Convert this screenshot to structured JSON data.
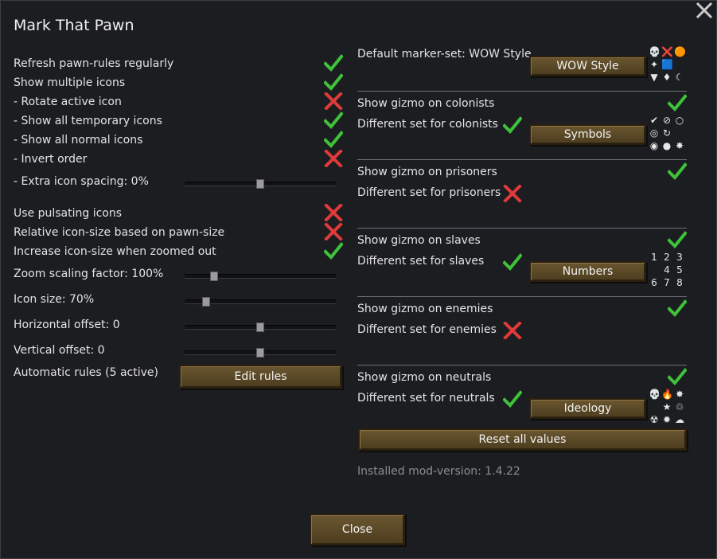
{
  "window": {
    "title": "Mark That Pawn",
    "close_glyph": "✕"
  },
  "left": {
    "toggles": [
      {
        "label": "Refresh pawn-rules regularly",
        "checked": true
      },
      {
        "label": "Show multiple icons",
        "checked": true
      },
      {
        "label": "- Rotate active icon",
        "checked": false
      },
      {
        "label": "- Show all temporary icons",
        "checked": true
      },
      {
        "label": "- Show all normal icons",
        "checked": true
      },
      {
        "label": "- Invert order",
        "checked": false
      }
    ],
    "extra_spacing": {
      "label": "- Extra icon spacing: 0%",
      "value_fraction": 0.5
    },
    "toggles2": [
      {
        "label": "Use pulsating icons",
        "checked": false
      },
      {
        "label": "Relative icon-size based on pawn-size",
        "checked": false
      },
      {
        "label": "Increase icon-size when zoomed out",
        "checked": true
      }
    ],
    "sliders": [
      {
        "label": "Zoom scaling factor: 100%",
        "value_fraction": 0.18
      },
      {
        "label": "Icon size: 70%",
        "value_fraction": 0.12
      },
      {
        "label": "Horizontal offset: 0",
        "value_fraction": 0.5
      },
      {
        "label": "Vertical offset: 0",
        "value_fraction": 0.5
      }
    ],
    "auto_rules": {
      "label": "Automatic rules (5 active)",
      "button": "Edit rules"
    }
  },
  "right": {
    "default_set": {
      "label": "Default marker-set: WOW Style",
      "button": "WOW Style",
      "icons": [
        "💀",
        "❌",
        "🟠",
        "✦",
        "🟦",
        "",
        "▼",
        "♦",
        "☾"
      ]
    },
    "colonists": {
      "gizmo_label": "Show gizmo on colonists",
      "gizmo_checked": true,
      "diff_label": "Different set for colonists",
      "diff_checked": true,
      "button": "Symbols",
      "icons": [
        "✔",
        "⊘",
        "○",
        "◎",
        "↻",
        "",
        "◉",
        "●",
        "✸"
      ]
    },
    "prisoners": {
      "gizmo_label": "Show gizmo on prisoners",
      "gizmo_checked": true,
      "diff_label": "Different set for prisoners",
      "diff_checked": false
    },
    "slaves": {
      "gizmo_label": "Show gizmo on slaves",
      "gizmo_checked": true,
      "diff_label": "Different set for slaves",
      "diff_checked": true,
      "button": "Numbers",
      "icons": [
        "1",
        "2",
        "3",
        "",
        "4",
        "5",
        "6",
        "7",
        "8"
      ]
    },
    "enemies": {
      "gizmo_label": "Show gizmo on enemies",
      "gizmo_checked": true,
      "diff_label": "Different set for enemies",
      "diff_checked": false
    },
    "neutrals": {
      "gizmo_label": "Show gizmo on neutrals",
      "gizmo_checked": true,
      "diff_label": "Different set for neutrals",
      "diff_checked": true,
      "button": "Ideology",
      "icons": [
        "💀",
        "🔥",
        "✸",
        "",
        "★",
        "♲",
        "☢",
        "✹",
        "☁"
      ]
    },
    "reset_button": "Reset all values",
    "version": "Installed mod-version: 1.4.22"
  },
  "footer": {
    "close_button": "Close"
  },
  "colors": {
    "check_green": "#3fc23a",
    "cross_red": "#e03a3a",
    "button_brown": "#5b4a28"
  }
}
